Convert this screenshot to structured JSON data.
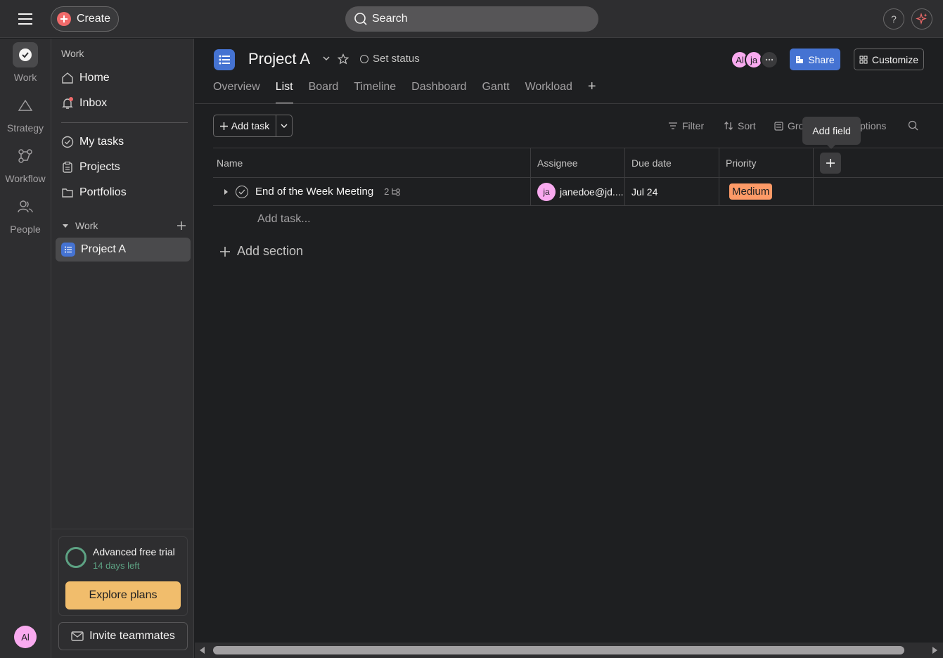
{
  "topbar": {
    "create_label": "Create",
    "search_label": "Search",
    "help_label": "?"
  },
  "rail": {
    "items": [
      {
        "label": "Work",
        "icon": "check-circle-icon"
      },
      {
        "label": "Strategy",
        "icon": "triangle-icon"
      },
      {
        "label": "Workflow",
        "icon": "workflow-icon"
      },
      {
        "label": "People",
        "icon": "people-icon"
      }
    ],
    "user_initials": "Al"
  },
  "sidebar": {
    "header": "Work",
    "nav": [
      {
        "label": "Home",
        "icon": "home-icon"
      },
      {
        "label": "Inbox",
        "icon": "bell-icon"
      }
    ],
    "nav2": [
      {
        "label": "My tasks",
        "icon": "check-circle-icon"
      },
      {
        "label": "Projects",
        "icon": "clipboard-icon"
      },
      {
        "label": "Portfolios",
        "icon": "folder-icon"
      }
    ],
    "section_label": "Work",
    "projects": [
      {
        "label": "Project A"
      }
    ],
    "trial": {
      "title": "Advanced free trial",
      "subtitle": "14 days left",
      "cta": "Explore plans"
    },
    "invite_label": "Invite teammates"
  },
  "project": {
    "title": "Project A",
    "status_label": "Set status",
    "members": [
      "Al",
      "ja"
    ],
    "share_label": "Share",
    "customize_label": "Customize",
    "tabs": [
      "Overview",
      "List",
      "Board",
      "Timeline",
      "Dashboard",
      "Gantt",
      "Workload"
    ],
    "active_tab": "List"
  },
  "toolbar": {
    "add_task_label": "Add task",
    "filter_label": "Filter",
    "sort_label": "Sort",
    "group_label": "Gro",
    "options_label": "ptions",
    "tooltip": "Add field"
  },
  "table": {
    "columns": [
      "Name",
      "Assignee",
      "Due date",
      "Priority"
    ],
    "rows": [
      {
        "name": "End of the Week Meeting",
        "subtasks": "2",
        "assignee_initials": "ja",
        "assignee": "janedoe@jd....",
        "due": "Jul 24",
        "priority": "Medium"
      }
    ],
    "add_task_placeholder": "Add task...",
    "add_section_label": "Add section"
  },
  "colors": {
    "accent_blue": "#4573d2",
    "create_red": "#f06a6a",
    "priority_medium": "#fd9a67",
    "trial_green": "#5da283",
    "explore_btn": "#f1bd6c",
    "avatar_pink": "#f9aaef"
  }
}
